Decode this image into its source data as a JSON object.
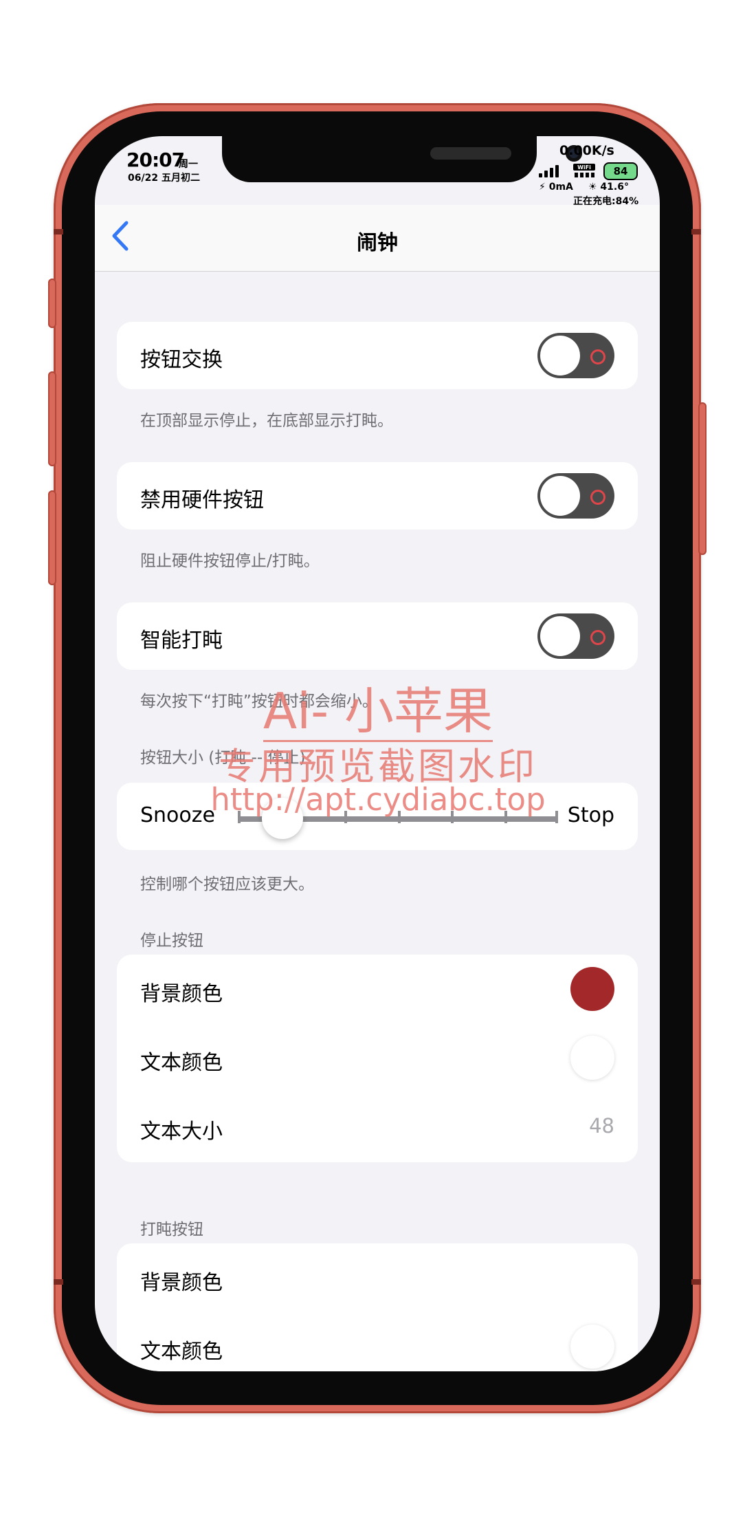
{
  "status_bar": {
    "time": "20:07",
    "weekday": "周一",
    "date": "06/22 五月初二",
    "net_speed": "0.00K/s",
    "battery_level": "84",
    "current": "⚡ 0mA",
    "temperature": "☀ 41.6°",
    "charging": "正在充电:84%"
  },
  "navbar": {
    "title": "闹钟",
    "back_icon": "chevron-left-icon"
  },
  "settings": {
    "button_swap": {
      "label": "按钮交换",
      "footer": "在顶部显示停止，在底部显示打盹。",
      "on": false
    },
    "disable_hw": {
      "label": "禁用硬件按钮",
      "footer": "阻止硬件按钮停止/打盹。",
      "on": false
    },
    "smart_snooze": {
      "label": "智能打盹",
      "footer": "每次按下“打盹”按钮时都会缩小。",
      "on": false
    },
    "button_size": {
      "header": "按钮大小 (打盹 -- 停止)",
      "min_label": "Snooze",
      "max_label": "Stop",
      "value_fraction": 0.14,
      "footer": "控制哪个按钮应该更大。"
    },
    "stop_button": {
      "header": "停止按钮",
      "bg_color_label": "背景颜色",
      "bg_color": "#a3282a",
      "text_color_label": "文本颜色",
      "text_color": "#ffffff",
      "text_size_label": "文本大小",
      "text_size": "48"
    },
    "snooze_button": {
      "header": "打盹按钮",
      "bg_color_label": "背景颜色",
      "text_color_label": "文本颜色",
      "text_color": "#ffffff"
    }
  },
  "watermark": {
    "line1": "Ai- 小苹果",
    "line2": "专用预览截图水印",
    "line3": "http://apt.cydiabc.top"
  },
  "colors": {
    "accent": "#3478f6",
    "toggle_off": "#4a4a4a",
    "frame": "#d9695a"
  }
}
